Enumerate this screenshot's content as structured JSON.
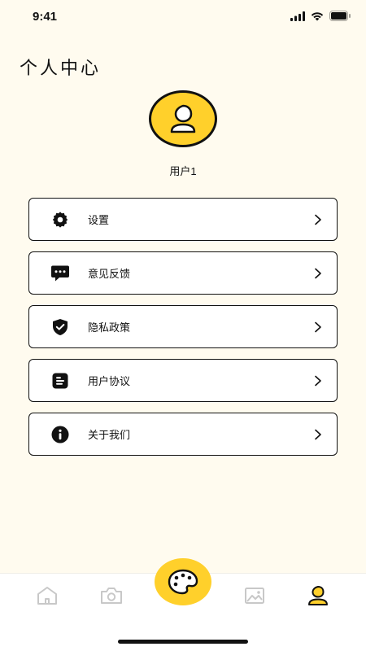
{
  "status_bar": {
    "time": "9:41"
  },
  "header": {
    "title": "个人中心"
  },
  "profile": {
    "username": "用户1"
  },
  "menu": {
    "items": [
      {
        "label": "设置",
        "icon": "gear-icon"
      },
      {
        "label": "意见反馈",
        "icon": "chat-bubble-icon"
      },
      {
        "label": "隐私政策",
        "icon": "shield-check-icon"
      },
      {
        "label": "用户协议",
        "icon": "document-icon"
      },
      {
        "label": "关于我们",
        "icon": "info-icon"
      }
    ],
    "chevron": ">"
  },
  "tab_bar": {
    "tabs": [
      {
        "icon": "home-icon",
        "active": false
      },
      {
        "icon": "camera-icon",
        "active": false
      },
      {
        "icon": "palette-icon",
        "active": false,
        "center": true
      },
      {
        "icon": "image-icon",
        "active": false
      },
      {
        "icon": "user-icon",
        "active": true
      }
    ]
  },
  "colors": {
    "background": "#FFFBEF",
    "accent": "#FFD02B",
    "text": "#111111",
    "inactive_icon": "#C8C8C8"
  }
}
